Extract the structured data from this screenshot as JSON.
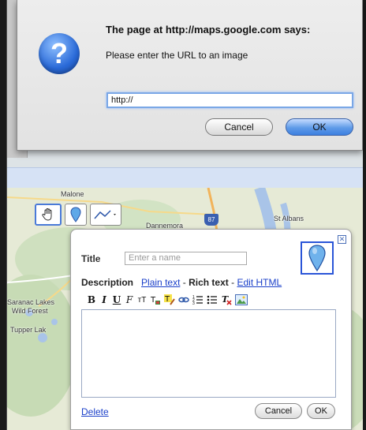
{
  "dialog": {
    "title": "The page at http://maps.google.com says:",
    "message": "Please enter the URL to an image",
    "input_value": "http://",
    "cancel_label": "Cancel",
    "ok_label": "OK",
    "icon": "question-icon"
  },
  "map": {
    "labels": {
      "malone": "Malone",
      "dannemora": "Dannemora",
      "st_albans": "St Albans",
      "saranac": "Saranac Lakes",
      "wild_forest": "Wild Forest",
      "tupper": "Tupper Lak",
      "highway": "87"
    },
    "tools": [
      "hand-icon",
      "placemark-icon",
      "line-icon"
    ]
  },
  "info_window": {
    "title_label": "Title",
    "title_placeholder": "Enter a name",
    "description_label": "Description",
    "plain_text_link": "Plain text",
    "separator": " - ",
    "rich_text": "Rich text",
    "edit_html_link": "Edit HTML",
    "delete_link": "Delete",
    "cancel_label": "Cancel",
    "ok_label": "OK",
    "toolbar": {
      "bold": "B",
      "italic": "I",
      "underline": "U",
      "font": "F",
      "size": "тT"
    }
  },
  "colors": {
    "link": "#1a3fc9",
    "accent": "#2a55d8",
    "default_button": "#3d7fe0"
  }
}
